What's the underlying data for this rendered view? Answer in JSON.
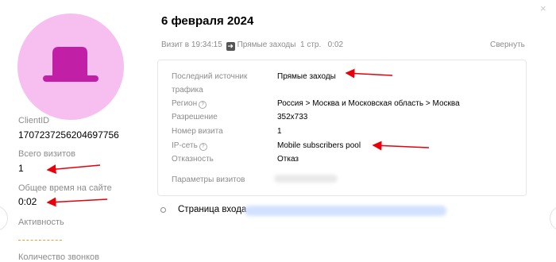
{
  "client": {
    "id_label": "ClientID",
    "id_value": "1707237256204697756",
    "visits_label": "Всего визитов",
    "visits_value": "1",
    "time_label": "Общее время на сайте",
    "time_value": "0:02",
    "activity_label": "Активность",
    "calls_label": "Количество звонков"
  },
  "visit": {
    "date": "6 февраля 2024",
    "time_prefix": "Визит в 19:34:15",
    "source": "Прямые заходы",
    "pages": "1 стр.",
    "duration": "0:02",
    "collapse_label": "Свернуть"
  },
  "details": {
    "last_source_label_1": "Последний источник",
    "last_source_label_2": "трафика",
    "last_source_value": "Прямые заходы",
    "region_label": "Регион",
    "region_value": "Россия > Москва и Московская область > Москва",
    "resolution_label": "Разрешение",
    "resolution_value": "352x733",
    "visit_number_label": "Номер визита",
    "visit_number_value": "1",
    "ip_label": "IP-сеть",
    "ip_value": "Mobile subscribers pool",
    "bounce_label": "Отказность",
    "bounce_value": "Отказ",
    "params_label": "Параметры визитов",
    "help_glyph": "?"
  },
  "entry": {
    "label": "Страница входа"
  },
  "icons": {
    "close": "×",
    "arrow": "➜"
  },
  "colors": {
    "avatar_bg": "#f6bff0",
    "hat": "#c21fa7",
    "annotation_arrow": "#e8000b"
  }
}
